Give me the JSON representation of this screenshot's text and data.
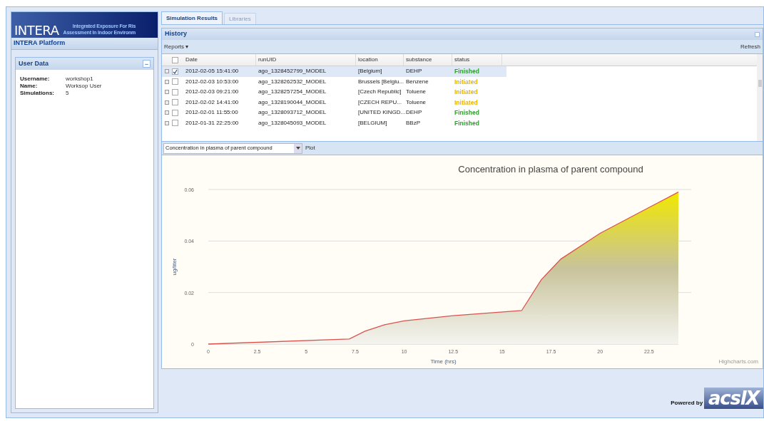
{
  "header": {
    "logo": "INTERA",
    "title_line_1": "Integrated Exposure For Ris",
    "title_line_2": "Assessment In Indoor Environm"
  },
  "sidebar": {
    "title": "INTERA Platform",
    "panel_title": "User Data",
    "collapse_button": "−",
    "fields": [
      {
        "label": "Username:",
        "value": "workshop1"
      },
      {
        "label": "Name:",
        "value": "Worksop User"
      },
      {
        "label": "Simulations:",
        "value": "5"
      }
    ]
  },
  "tabs": [
    {
      "label": "Simulation Results",
      "selected": true
    },
    {
      "label": "Libraries",
      "selected": false
    }
  ],
  "history": {
    "title": "History",
    "reports_menu": "Reports ▾",
    "refresh_button": "Refresh",
    "columns": [
      "Date",
      "runUID",
      "location",
      "substance",
      "status"
    ],
    "select_all_checked": false,
    "rows": [
      {
        "date": "2012-02-05 15:41:00",
        "run_uid": "ago_1328452799_MODEL",
        "location": "[Belgium]",
        "substance": "DEHP",
        "status": "Finished",
        "color": "#2e9e2e",
        "selected": true,
        "checked": true
      },
      {
        "date": "2012-02-03 10:53:00",
        "run_uid": "ago_1328262532_MODEL",
        "location": "Brussels [Belgiu...",
        "substance": "Benzene",
        "status": "Initiated",
        "color": "#e8b400",
        "selected": false,
        "checked": false
      },
      {
        "date": "2012-02-03 09:21:00",
        "run_uid": "ago_1328257254_MODEL",
        "location": "[Czech Republic]",
        "substance": "Toluene",
        "status": "Initiated",
        "color": "#e8b400",
        "selected": false,
        "checked": false
      },
      {
        "date": "2012-02-02 14:41:00",
        "run_uid": "ago_1328190044_MODEL",
        "location": "[CZECH REPU...",
        "substance": "Toluene",
        "status": "Initiated",
        "color": "#e8b400",
        "selected": false,
        "checked": false
      },
      {
        "date": "2012-02-01 11:55:00",
        "run_uid": "ago_1328093712_MODEL",
        "location": "[UNITED KINGD...",
        "substance": "DEHP",
        "status": "Finished",
        "color": "#2e9e2e",
        "selected": false,
        "checked": false
      },
      {
        "date": "2012-01-31 22:25:00",
        "run_uid": "ago_1328045093_MODEL",
        "location": "[BELGIUM]",
        "substance": "BBzP",
        "status": "Finished",
        "color": "#2e9e2e",
        "selected": false,
        "checked": false
      }
    ]
  },
  "plot": {
    "select_value": "Concentration in plasma of parent compound",
    "plot_button": "Plot",
    "credits": "Highcharts.com",
    "chart_data": {
      "type": "area",
      "title": "Concentration in plasma of parent compound",
      "xlabel": "Time (hrs)",
      "ylabel": "ug/liter",
      "x": [
        0,
        7.2,
        8,
        9,
        10,
        12.5,
        16,
        17,
        18,
        20,
        22.5,
        24
      ],
      "series": [
        {
          "color": "#d9534f",
          "values": [
            0,
            0.002,
            0.005,
            0.0075,
            0.009,
            0.011,
            0.013,
            0.025,
            0.033,
            0.043,
            0.053,
            0.059
          ]
        }
      ],
      "xlim": [
        0,
        24
      ],
      "ylim": [
        0,
        0.06
      ],
      "xticks": [
        0,
        2.5,
        5,
        7.5,
        10,
        12.5,
        15,
        17.5,
        20,
        22.5
      ],
      "yticks": [
        0,
        0.02,
        0.04,
        0.06
      ]
    }
  },
  "footer": {
    "powered_by": "Powered by",
    "brand": "acslX"
  }
}
